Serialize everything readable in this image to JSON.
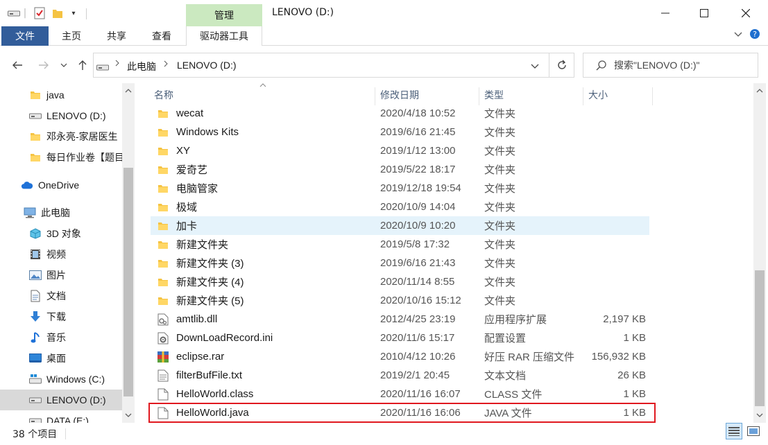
{
  "window": {
    "title": "LENOVO (D:)",
    "context_tab": "管理"
  },
  "ribbon": {
    "tabs": [
      "文件",
      "主页",
      "共享",
      "查看",
      "驱动器工具"
    ]
  },
  "address": {
    "crumbs": [
      "此电脑",
      "LENOVO (D:)"
    ]
  },
  "search": {
    "placeholder": "搜索\"LENOVO (D:)\""
  },
  "nav": {
    "items": [
      {
        "label": "java",
        "icon": "folder-icon"
      },
      {
        "label": "LENOVO (D:)",
        "icon": "drive-icon"
      },
      {
        "label": "邓永亮-家居医生",
        "icon": "folder-icon"
      },
      {
        "label": "每日作业卷【题目",
        "icon": "folder-icon"
      },
      {
        "label": "OneDrive",
        "icon": "cloud-icon"
      },
      {
        "label": "此电脑",
        "icon": "computer-icon"
      },
      {
        "label": "3D 对象",
        "icon": "cube-icon"
      },
      {
        "label": "视频",
        "icon": "video-icon"
      },
      {
        "label": "图片",
        "icon": "picture-icon"
      },
      {
        "label": "文档",
        "icon": "document-icon"
      },
      {
        "label": "下载",
        "icon": "download-icon"
      },
      {
        "label": "音乐",
        "icon": "music-icon"
      },
      {
        "label": "桌面",
        "icon": "desktop-icon"
      },
      {
        "label": "Windows (C:)",
        "icon": "windows-drive-icon"
      },
      {
        "label": "LENOVO (D:)",
        "icon": "drive-icon"
      },
      {
        "label": "DATA (E:)",
        "icon": "drive-icon"
      }
    ]
  },
  "columns": {
    "name": "名称",
    "date": "修改日期",
    "type": "类型",
    "size": "大小"
  },
  "files": [
    {
      "name": "wecat",
      "date": "2020/4/18 10:52",
      "type": "文件夹",
      "size": "",
      "icon": "folder-icon"
    },
    {
      "name": "Windows Kits",
      "date": "2019/6/16 21:45",
      "type": "文件夹",
      "size": "",
      "icon": "folder-icon"
    },
    {
      "name": "XY",
      "date": "2019/1/12 13:00",
      "type": "文件夹",
      "size": "",
      "icon": "folder-icon"
    },
    {
      "name": "爱奇艺",
      "date": "2019/5/22 18:17",
      "type": "文件夹",
      "size": "",
      "icon": "folder-icon"
    },
    {
      "name": "电脑管家",
      "date": "2019/12/18 19:54",
      "type": "文件夹",
      "size": "",
      "icon": "folder-icon"
    },
    {
      "name": "极域",
      "date": "2020/10/9 14:04",
      "type": "文件夹",
      "size": "",
      "icon": "folder-icon"
    },
    {
      "name": "加卡",
      "date": "2020/10/9 10:20",
      "type": "文件夹",
      "size": "",
      "icon": "folder-icon"
    },
    {
      "name": "新建文件夹",
      "date": "2019/5/8 17:32",
      "type": "文件夹",
      "size": "",
      "icon": "folder-icon"
    },
    {
      "name": "新建文件夹 (3)",
      "date": "2019/6/16 21:43",
      "type": "文件夹",
      "size": "",
      "icon": "folder-icon"
    },
    {
      "name": "新建文件夹 (4)",
      "date": "2020/11/14 8:55",
      "type": "文件夹",
      "size": "",
      "icon": "folder-icon"
    },
    {
      "name": "新建文件夹 (5)",
      "date": "2020/10/16 15:12",
      "type": "文件夹",
      "size": "",
      "icon": "folder-icon"
    },
    {
      "name": "amtlib.dll",
      "date": "2012/4/25 23:19",
      "type": "应用程序扩展",
      "size": "2,197 KB",
      "icon": "dll-icon"
    },
    {
      "name": "DownLoadRecord.ini",
      "date": "2020/11/6 15:17",
      "type": "配置设置",
      "size": "1 KB",
      "icon": "settings-file-icon"
    },
    {
      "name": "eclipse.rar",
      "date": "2010/4/12 10:26",
      "type": "好压 RAR 压缩文件",
      "size": "156,932 KB",
      "icon": "archive-icon"
    },
    {
      "name": "filterBufFile.txt",
      "date": "2019/2/1 20:45",
      "type": "文本文档",
      "size": "26 KB",
      "icon": "text-file-icon"
    },
    {
      "name": "HelloWorld.class",
      "date": "2020/11/16 16:07",
      "type": "CLASS 文件",
      "size": "1 KB",
      "icon": "file-icon"
    },
    {
      "name": "HelloWorld.java",
      "date": "2020/11/16 16:06",
      "type": "JAVA 文件",
      "size": "1 KB",
      "icon": "file-icon"
    }
  ],
  "status": {
    "count": "38 个项目"
  },
  "colors": {
    "folder": "#f5c342",
    "highlight": "#e0181f",
    "manage_tab": "#cbe9c0",
    "file_tab": "#325d9a"
  }
}
